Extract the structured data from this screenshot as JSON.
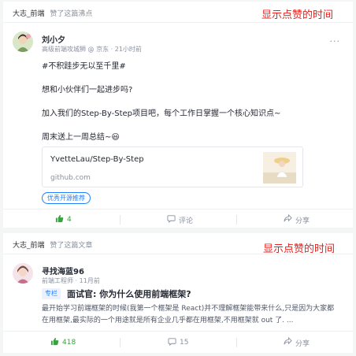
{
  "colors": {
    "accent": "#1e80ff",
    "like_green": "#37a33c",
    "annotation_red": "#e8201c"
  },
  "card1": {
    "actor": "大志_前端",
    "action": "赞了这篇沸点",
    "annotation": "显示点赞的时间",
    "author": {
      "name": "刘小夕",
      "title": "高级前端攻城狮",
      "dot": "@",
      "company": "京东",
      "sep": "·",
      "time": "21小时前"
    },
    "more": "···",
    "lines": [
      "#不积跬步无以至千里#",
      "想和小伙伴们一起进步吗?",
      "加入我们的Step-By-Step项目吧，每个工作日掌握一个核心知识点~",
      "周末送上一周总结~😃"
    ],
    "link": {
      "title": "YvetteLau/Step-By-Step",
      "host": "github.com"
    },
    "tag": "优秀开源推荐",
    "actions": {
      "likes": "4",
      "comment": "评论",
      "share": "分享"
    }
  },
  "card2": {
    "actor": "大志_前端",
    "action": "赞了这篇文章",
    "annotation": "显示点赞的时间",
    "author": {
      "name": "寻找海蓝96",
      "title": "前端工程师",
      "sep": "·",
      "time": "11月前"
    },
    "column_tag": "专栏",
    "title": "面试官: 你为什么使用前端框架?",
    "body": "最开始学习前端框架的时候(我第一个框架是 React)并不理解框架能带来什么,只是因为大家都在用框架,最实际的一个用途就是所有企业几乎都在用框架,不用框架就 out 了. ...",
    "actions": {
      "likes": "418",
      "comments": "15",
      "share": "分享"
    }
  },
  "icons": {
    "like": "thumbs-up-icon",
    "comment": "comment-icon",
    "share": "share-icon",
    "more": "more-icon"
  }
}
